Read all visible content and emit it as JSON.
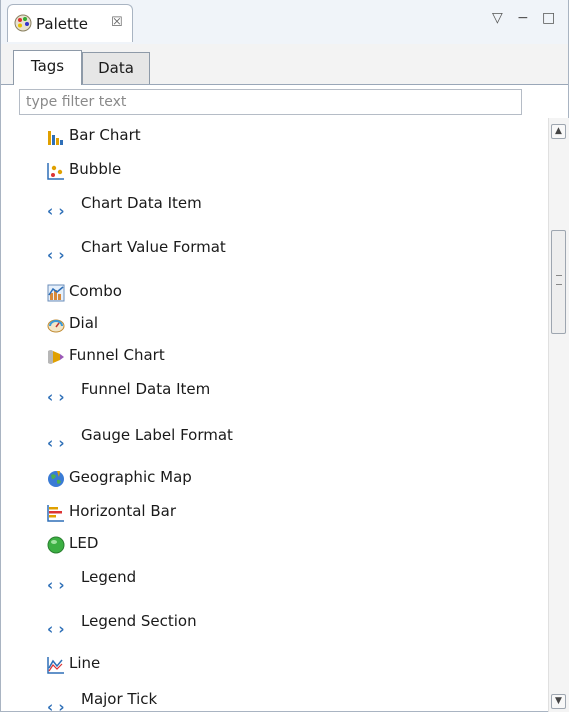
{
  "view": {
    "title": "Palette",
    "close_glyph": "☒",
    "icon": "palette-icon"
  },
  "window_controls": {
    "view_menu": "▽",
    "minimize": "−",
    "maximize": "□"
  },
  "subtabs": [
    {
      "label": "Tags",
      "active": true
    },
    {
      "label": "Data",
      "active": false
    }
  ],
  "filter": {
    "placeholder": "type filter text",
    "value": ""
  },
  "items": [
    {
      "label": "Bar Chart",
      "icon": "bar-chart-icon",
      "kind": "chart"
    },
    {
      "label": "Bubble",
      "icon": "bubble-icon",
      "kind": "chart"
    },
    {
      "label": "Chart Data Item",
      "icon": "tag-icon",
      "kind": "tag"
    },
    {
      "label": "Chart Value Format",
      "icon": "tag-icon",
      "kind": "tag"
    },
    {
      "label": "Combo",
      "icon": "combo-chart-icon",
      "kind": "chart"
    },
    {
      "label": "Dial",
      "icon": "dial-icon",
      "kind": "chart"
    },
    {
      "label": "Funnel Chart",
      "icon": "funnel-icon",
      "kind": "chart"
    },
    {
      "label": "Funnel Data Item",
      "icon": "tag-icon",
      "kind": "tag"
    },
    {
      "label": "Gauge Label Format",
      "icon": "tag-icon",
      "kind": "tag"
    },
    {
      "label": "Geographic Map",
      "icon": "globe-icon",
      "kind": "chart"
    },
    {
      "label": "Horizontal Bar",
      "icon": "horizontal-bar-icon",
      "kind": "chart"
    },
    {
      "label": "LED",
      "icon": "led-icon",
      "kind": "chart"
    },
    {
      "label": "Legend",
      "icon": "tag-icon",
      "kind": "tag"
    },
    {
      "label": "Legend Section",
      "icon": "tag-icon",
      "kind": "tag"
    },
    {
      "label": "Line",
      "icon": "line-chart-icon",
      "kind": "chart"
    },
    {
      "label": "Major Tick",
      "icon": "tag-icon",
      "kind": "tag"
    }
  ],
  "colors": {
    "accent": "#2e6fb7",
    "header_bg": "#f0f4f9",
    "led_green": "#3cb043"
  }
}
